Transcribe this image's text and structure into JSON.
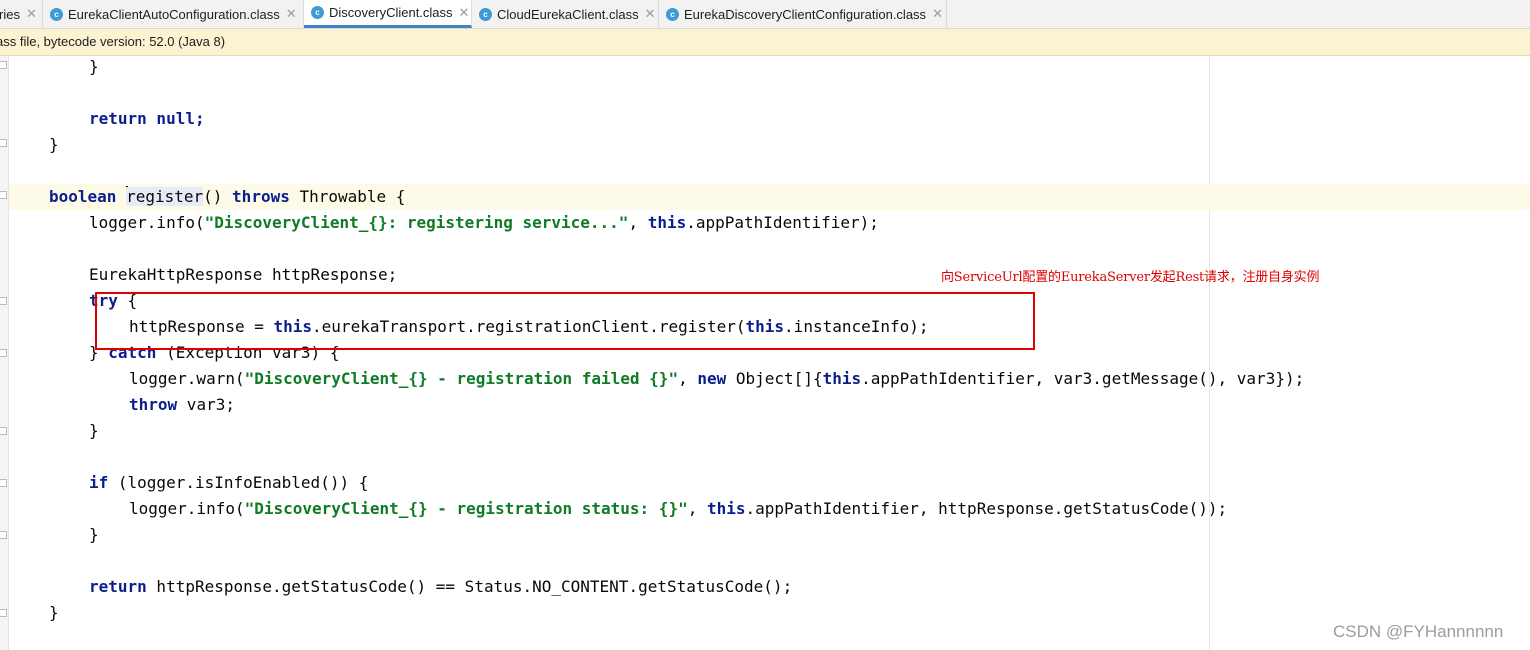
{
  "tabs": [
    {
      "label": "ries",
      "active": false
    },
    {
      "label": "EurekaClientAutoConfiguration.class",
      "active": false
    },
    {
      "label": "DiscoveryClient.class",
      "active": true
    },
    {
      "label": "CloudEurekaClient.class",
      "active": false
    },
    {
      "label": "EurekaDiscoveryClientConfiguration.class",
      "active": false
    }
  ],
  "infobar": {
    "text": "ass file, bytecode version: 52.0 (Java 8)"
  },
  "code": {
    "l1_brace": "}",
    "l2_return": "return",
    "l2_rest": " null;",
    "l3_brace": "}",
    "l4_boolean": "boolean",
    "l4_register": "register",
    "l4_rest1": "() ",
    "l4_throws": "throws",
    "l4_rest2": " Throwable {",
    "l5_a": "logger.info(",
    "l5_str": "\"DiscoveryClient_{}: registering service...\"",
    "l5_b": ", ",
    "l5_this": "this",
    "l5_c": ".appPathIdentifier);",
    "l6": "EurekaHttpResponse httpResponse;",
    "l7_try": "try",
    "l7_rest": " {",
    "l8_a": "httpResponse = ",
    "l8_this1": "this",
    "l8_b": ".eurekaTransport.registrationClient.register(",
    "l8_this2": "this",
    "l8_c": ".instanceInfo);",
    "l9_a": "} ",
    "l9_catch": "catch",
    "l9_b": " (Exception var3) {",
    "l10_a": "logger.warn(",
    "l10_str": "\"DiscoveryClient_{} - registration failed {}\"",
    "l10_b": ", ",
    "l10_new": "new",
    "l10_c": " Object[]{",
    "l10_this": "this",
    "l10_d": ".appPathIdentifier, var3.getMessage(), var3});",
    "l11_throw": "throw",
    "l11_rest": " var3;",
    "l12_brace": "}",
    "l13_if": "if",
    "l13_rest": " (logger.isInfoEnabled()) {",
    "l14_a": "logger.info(",
    "l14_str": "\"DiscoveryClient_{} - registration status: {}\"",
    "l14_b": ", ",
    "l14_this": "this",
    "l14_c": ".appPathIdentifier, httpResponse.getStatusCode());",
    "l15_brace": "}",
    "l16_return": "return",
    "l16_rest": " httpResponse.getStatusCode() == Status.NO_CONTENT.getStatusCode();",
    "l17_brace": "}"
  },
  "annotation": {
    "text": "向ServiceUrl配置的EurekaServer发起Rest请求，注册自身实例",
    "color": "#e00000"
  },
  "watermark": {
    "text": "CSDN @FYHannnnnn"
  },
  "colors": {
    "keyword": "#0b1f8c",
    "string": "#107b25",
    "tab_active_underline": "#4083c9",
    "infobar_bg": "#fbf3d2"
  }
}
